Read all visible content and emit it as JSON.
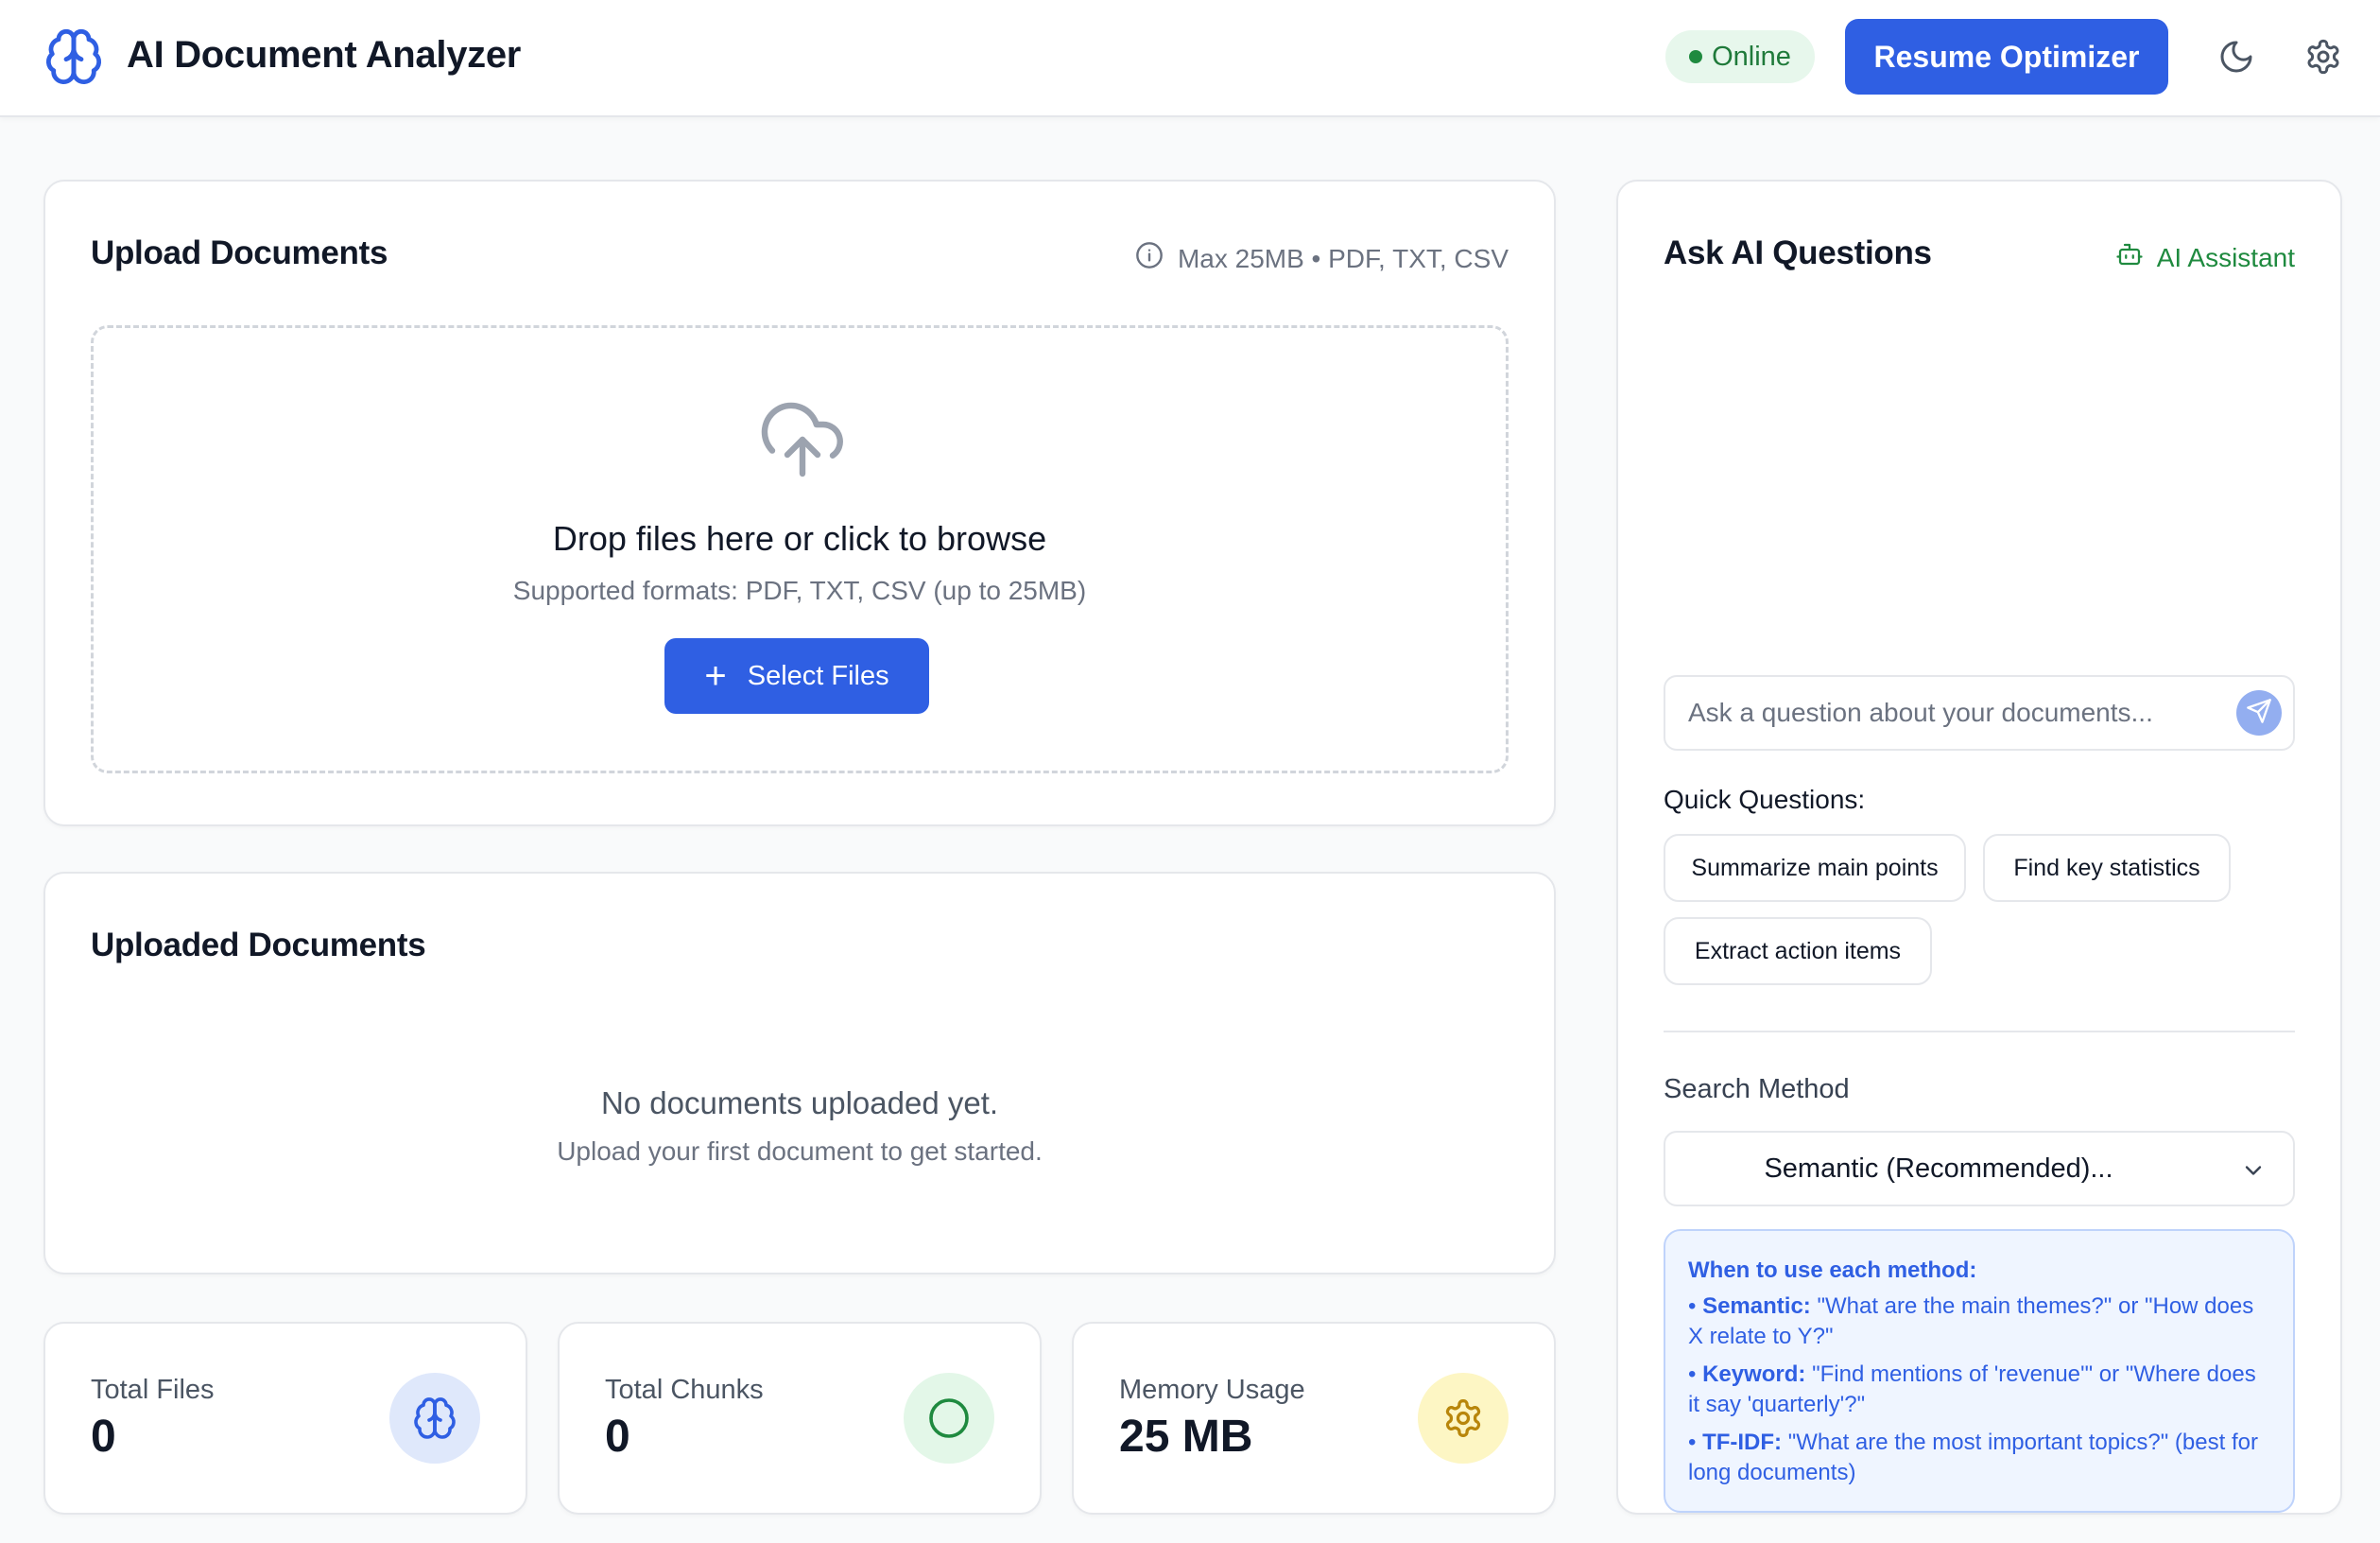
{
  "header": {
    "app_title": "AI Document Analyzer",
    "logo_icon": "brain-icon",
    "status": "Online",
    "primary_button": "Resume Optimizer",
    "theme_icon": "moon-icon",
    "settings_icon": "gear-icon"
  },
  "upload": {
    "title": "Upload Documents",
    "info": "Max 25MB • PDF, TXT, CSV",
    "drop_title": "Drop files here or click to browse",
    "drop_sub": "Supported formats: PDF, TXT, CSV (up to 25MB)",
    "select_button": "Select Files"
  },
  "documents": {
    "title": "Uploaded Documents",
    "empty_title": "No documents uploaded yet.",
    "empty_sub": "Upload your first document to get started."
  },
  "stats": [
    {
      "label": "Total Files",
      "value": "0",
      "icon": "brain-icon",
      "color": "#dfe8fb"
    },
    {
      "label": "Total Chunks",
      "value": "0",
      "icon": "circle-icon",
      "color": "#e3f7e8"
    },
    {
      "label": "Memory Usage",
      "value": "25 MB",
      "icon": "gear-icon",
      "color": "#fdf6c4"
    }
  ],
  "ai": {
    "title": "Ask AI Questions",
    "assistant_label": "AI Assistant",
    "input_placeholder": "Ask a question about your documents...",
    "quick_label": "Quick Questions:",
    "quick": [
      "Summarize main points",
      "Find key statistics",
      "Extract action items"
    ],
    "search_label": "Search Method",
    "search_value": "Semantic (Recommended)...",
    "help": {
      "title": "When to use each method:",
      "items": [
        {
          "name": "Semantic:",
          "text": "\"What are the main themes?\" or \"How does X relate to Y?\""
        },
        {
          "name": "Keyword:",
          "text": "\"Find mentions of 'revenue'\" or \"Where does it say 'quarterly'?\""
        },
        {
          "name": "TF-IDF:",
          "text": "\"What are the most important topics?\" (best for long documents)"
        }
      ]
    }
  },
  "colors": {
    "accent": "#2f5fe3",
    "online": "#1f8a3f",
    "background": "#f9fafb"
  }
}
